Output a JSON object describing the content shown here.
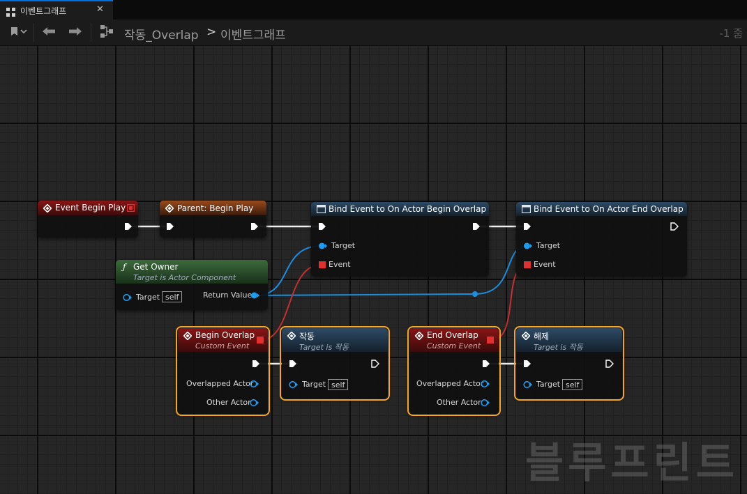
{
  "tab": {
    "title": "이벤트그래프",
    "icon": "graph-icon",
    "close_icon": "close-icon"
  },
  "toolbar": {
    "bookmark_icon": "bookmark-icon",
    "back_icon": "back-arrow-icon",
    "forward_icon": "forward-arrow-icon",
    "graph_icon": "graph-icon",
    "breadcrumb": {
      "blueprint": "작동_Overlap",
      "separator": ">",
      "graph": "이벤트그래프"
    },
    "zoom": "-1 줌"
  },
  "nodes": {
    "event_begin_play": {
      "title": "Event Begin Play"
    },
    "parent_begin_play": {
      "title": "Parent: Begin Play"
    },
    "bind_begin": {
      "title": "Bind Event to On Actor Begin Overlap",
      "pins": {
        "target": "Target",
        "event": "Event"
      }
    },
    "bind_end": {
      "title": "Bind Event to On Actor End Overlap",
      "pins": {
        "target": "Target",
        "event": "Event"
      }
    },
    "get_owner": {
      "title": "Get Owner",
      "subtitle": "Target is Actor Component",
      "pins": {
        "target": "Target",
        "self": "self",
        "return": "Return Value"
      }
    },
    "begin_overlap": {
      "title": "Begin Overlap",
      "subtitle": "Custom Event",
      "pins": {
        "overlapped": "Overlapped Actor",
        "other": "Other Actor"
      }
    },
    "act": {
      "title": "작동",
      "subtitle": "Target is 작동",
      "pins": {
        "target": "Target",
        "self": "self"
      }
    },
    "end_overlap": {
      "title": "End Overlap",
      "subtitle": "Custom Event",
      "pins": {
        "overlapped": "Overlapped Actor",
        "other": "Other Actor"
      }
    },
    "release": {
      "title": "해제",
      "subtitle": "Target is 작동",
      "pins": {
        "target": "Target",
        "self": "self"
      }
    }
  },
  "colors": {
    "exec": "#ffffff",
    "object_pin": "#1aa3ff",
    "delegate_pin": "#e03030",
    "selection": "#f5a623"
  },
  "watermark": "블루프린트"
}
